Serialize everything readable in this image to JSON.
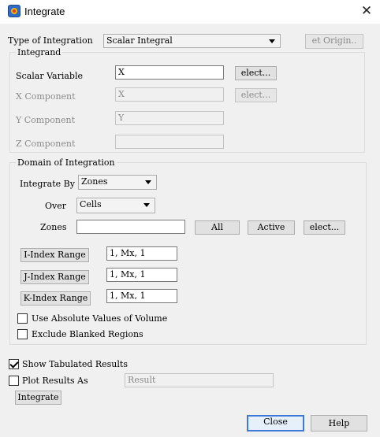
{
  "window": {
    "title": "Integrate"
  },
  "type_of_integration": {
    "label": "Type of Integration",
    "value": "Scalar Integral",
    "origin_button": "et Origin.."
  },
  "integrand": {
    "group_label": "Integrand",
    "scalar_variable": {
      "label": "Scalar Variable",
      "value": "X",
      "select_button": "elect..."
    },
    "x_component": {
      "label": "X Component",
      "value": "X",
      "select_button": "elect..."
    },
    "y_component": {
      "label": "Y Component",
      "value": "Y"
    },
    "z_component": {
      "label": "Z Component",
      "value": ""
    }
  },
  "domain": {
    "group_label": "Domain of Integration",
    "integrate_by": {
      "label": "Integrate By",
      "value": "Zones"
    },
    "over": {
      "label": "Over",
      "value": "Cells"
    },
    "zones": {
      "label": "Zones",
      "value": "",
      "all_button": "All",
      "active_button": "Active",
      "select_button": "elect..."
    },
    "i_range": {
      "button": "I-Index Range",
      "value": "1, Mx, 1"
    },
    "j_range": {
      "button": "J-Index Range",
      "value": "1, Mx, 1"
    },
    "k_range": {
      "button": "K-Index Range",
      "value": "1, Mx, 1"
    },
    "use_absolute": {
      "label": "Use Absolute Values of Volume",
      "checked": false
    },
    "exclude_blanked": {
      "label": "Exclude Blanked Regions",
      "checked": false
    }
  },
  "show_tabulated": {
    "label": "Show Tabulated Results",
    "checked": true
  },
  "plot_results": {
    "label": "Plot Results As",
    "checked": false,
    "value": "Result"
  },
  "buttons": {
    "integrate": "Integrate",
    "close": "Close",
    "help": "Help"
  }
}
